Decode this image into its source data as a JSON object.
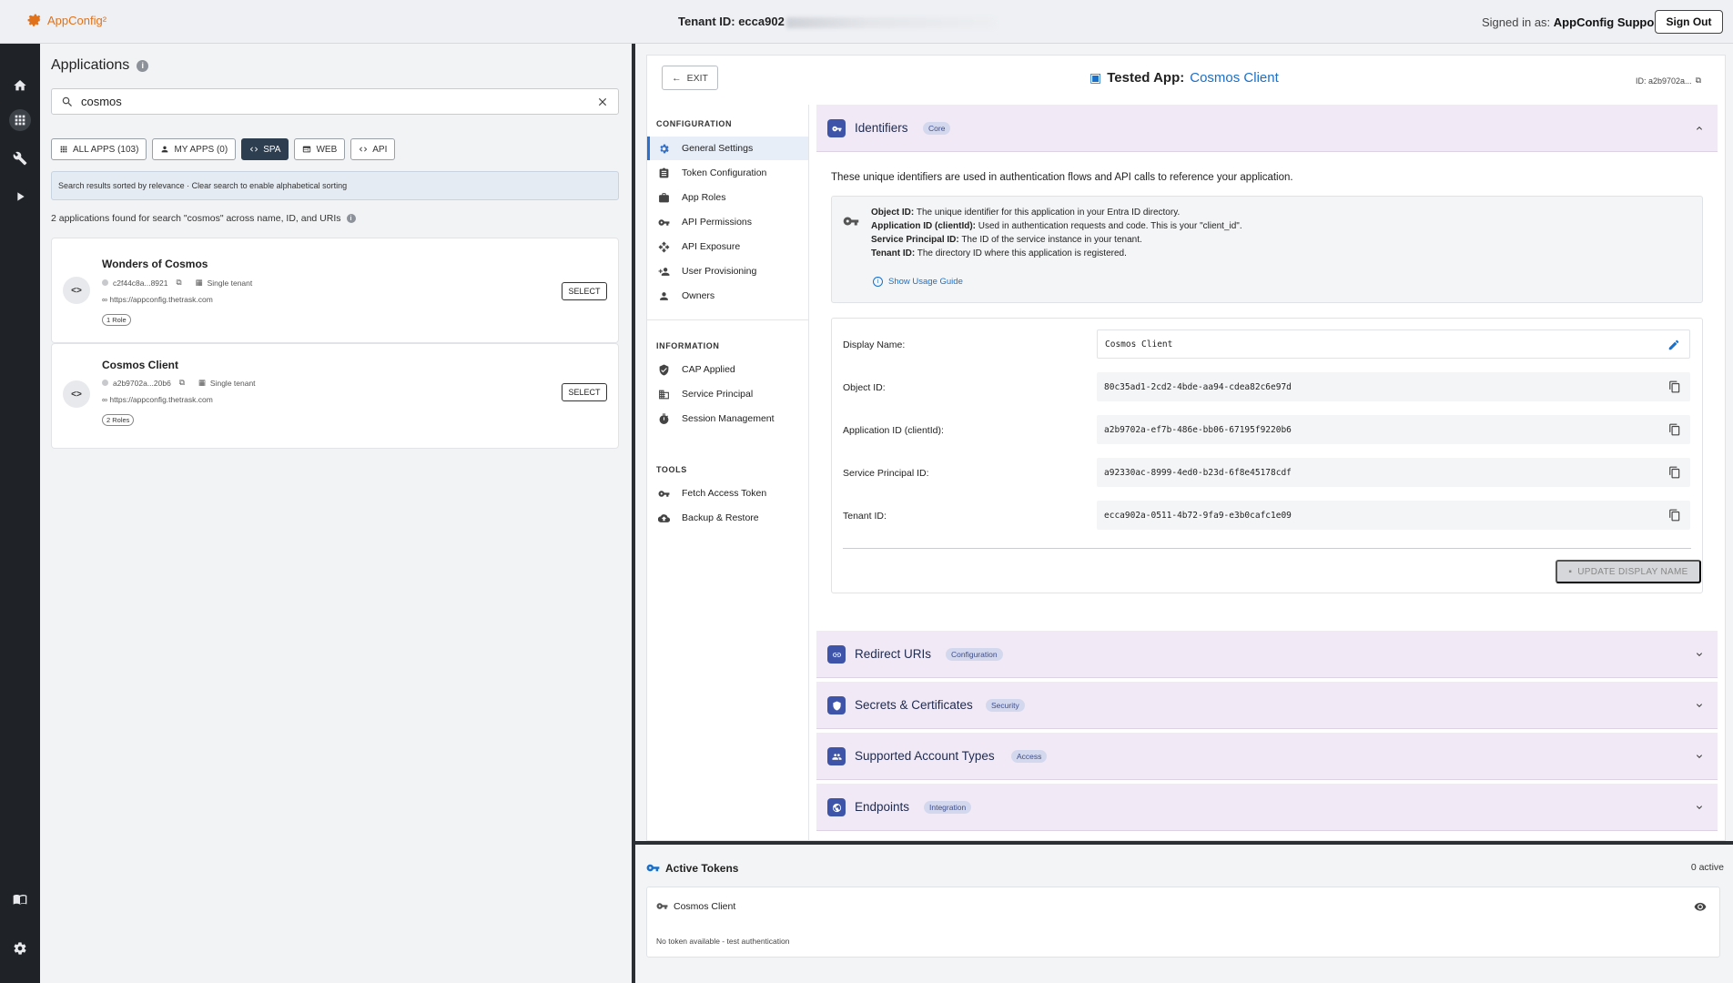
{
  "header": {
    "logo_text": "AppConfig²",
    "tenant_label": "Tenant ID: ecca902",
    "signed_prefix": "Signed in as:",
    "signed_user": "AppConfig Support",
    "sign_out": "Sign Out"
  },
  "rail": {
    "icons": [
      "home-icon",
      "apps-grid-icon",
      "wrench-icon",
      "play-icon",
      "book-icon",
      "gear-icon"
    ]
  },
  "apps_panel": {
    "title": "Applications",
    "search_value": "cosmos",
    "filters": [
      {
        "label": "ALL APPS (103)",
        "active": false
      },
      {
        "label": "MY APPS (0)",
        "active": false
      },
      {
        "label": "SPA",
        "active": true
      },
      {
        "label": "WEB",
        "active": false
      },
      {
        "label": "API",
        "active": false
      }
    ],
    "sort_note": "Search results sorted by relevance · Clear search to enable alphabetical sorting",
    "found_text": "2 applications found for search \"cosmos\" across name, ID, and URIs",
    "apps": [
      {
        "name": "Wonders of Cosmos",
        "id": "c2f44c8a...8921",
        "tenancy": "Single tenant",
        "url": "https://appconfig.thetrask.com",
        "roles": "1 Role",
        "select": "SELECT"
      },
      {
        "name": "Cosmos Client",
        "id": "a2b9702a...20b6",
        "tenancy": "Single tenant",
        "url": "https://appconfig.thetrask.com",
        "roles": "2 Roles",
        "select": "SELECT"
      }
    ]
  },
  "detail": {
    "exit": "EXIT",
    "tested_label": "Tested App:",
    "tested_app": "Cosmos Client",
    "id_short": "ID: a2b9702a...",
    "nav": {
      "configuration_title": "CONFIGURATION",
      "configuration": [
        "General Settings",
        "Token Configuration",
        "App Roles",
        "API Permissions",
        "API Exposure",
        "User Provisioning",
        "Owners"
      ],
      "information_title": "INFORMATION",
      "information": [
        "CAP Applied",
        "Service Principal",
        "Session Management"
      ],
      "tools_title": "TOOLS",
      "tools": [
        "Fetch Access Token",
        "Backup & Restore"
      ]
    },
    "identifiers": {
      "title": "Identifiers",
      "badge": "Core",
      "description": "These unique identifiers are used in authentication flows and API calls to reference your application.",
      "info_lines": [
        {
          "bold": "Object ID:",
          "text": " The unique identifier for this application in your Entra ID directory."
        },
        {
          "bold": "Application ID (clientId):",
          "text": " Used in authentication requests and code. This is your \"client_id\"."
        },
        {
          "bold": "Service Principal ID:",
          "text": " The ID of the service instance in your tenant."
        },
        {
          "bold": "Tenant ID:",
          "text": " The directory ID where this application is registered."
        }
      ],
      "guide_link": "Show Usage Guide",
      "fields": [
        {
          "label": "Display Name:",
          "value": "Cosmos Client"
        },
        {
          "label": "Object ID:",
          "value": "80c35ad1-2cd2-4bde-aa94-cdea82c6e97d"
        },
        {
          "label": "Application ID (clientId):",
          "value": "a2b9702a-ef7b-486e-bb06-67195f9220b6"
        },
        {
          "label": "Service Principal ID:",
          "value": "a92330ac-8999-4ed0-b23d-6f8e45178cdf"
        },
        {
          "label": "Tenant ID:",
          "value": "ecca902a-0511-4b72-9fa9-e3b0cafc1e09"
        }
      ],
      "update_button": "UPDATE DISPLAY NAME"
    },
    "sections": [
      {
        "title": "Redirect URIs",
        "badge": "Configuration"
      },
      {
        "title": "Secrets & Certificates",
        "badge": "Security"
      },
      {
        "title": "Supported Account Types",
        "badge": "Access"
      },
      {
        "title": "Endpoints",
        "badge": "Integration"
      }
    ]
  },
  "tokens": {
    "title": "Active Tokens",
    "count": "0 active",
    "item_name": "Cosmos Client",
    "item_status": "No token available - test authentication"
  }
}
